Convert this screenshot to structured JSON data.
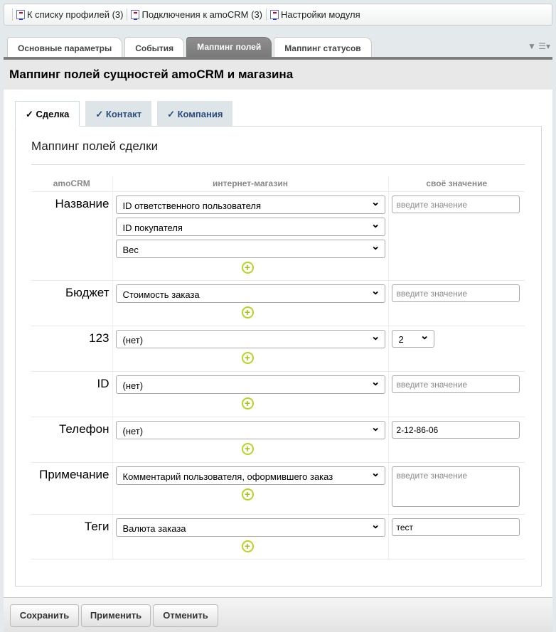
{
  "toolbar": {
    "items": [
      "К списку профилей (3)",
      "Подключения к amoCRM (3)",
      "Настройки модуля"
    ]
  },
  "tabs": [
    "Основные параметры",
    "События",
    "Маппинг полей",
    "Маппинг статусов"
  ],
  "page_title": "Маппинг полей сущностей amoCRM и магазина",
  "subtabs": [
    "✓ Сделка",
    "✓ Контакт",
    "✓ Компания"
  ],
  "section_title": "Маппинг полей сделки",
  "columns": [
    "amoCRM",
    "интернет-магазин",
    "своё значение"
  ],
  "placeholder": "введите значение",
  "rows": [
    {
      "label": "Название",
      "selects": [
        "ID ответственного пользователя",
        "ID покупателя",
        "Вес"
      ],
      "value": ""
    },
    {
      "label": "Бюджет",
      "selects": [
        "Стоимость заказа"
      ],
      "value": ""
    },
    {
      "label": "123",
      "selects": [
        "(нет)"
      ],
      "value": "2"
    },
    {
      "label": "ID",
      "selects": [
        "(нет)"
      ],
      "value": ""
    },
    {
      "label": "Телефон",
      "selects": [
        "(нет)"
      ],
      "value": "2-12-86-06"
    },
    {
      "label": "Примечание",
      "selects": [
        "Комментарий пользователя, оформившего заказ"
      ],
      "value": ""
    },
    {
      "label": "Теги",
      "selects": [
        "Валюта заказа"
      ],
      "value": "тест"
    }
  ],
  "buttons": {
    "save": "Сохранить",
    "apply": "Применить",
    "cancel": "Отменить"
  }
}
